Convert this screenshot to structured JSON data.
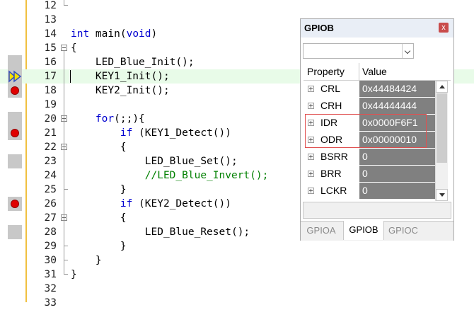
{
  "editor": {
    "lines": [
      {
        "num": "12",
        "segments": [],
        "fold": "end-top"
      },
      {
        "num": "13",
        "segments": []
      },
      {
        "num": "14",
        "segments": [
          {
            "t": "int",
            "c": "kw"
          },
          {
            "t": " main(",
            "c": ""
          },
          {
            "t": "void",
            "c": "kw"
          },
          {
            "t": ")",
            "c": ""
          }
        ]
      },
      {
        "num": "15",
        "segments": [
          {
            "t": "{",
            "c": ""
          }
        ],
        "fold": "box"
      },
      {
        "num": "16",
        "segments": [
          {
            "t": "    LED_Blue_Init();",
            "c": ""
          }
        ],
        "gutter": "gray"
      },
      {
        "num": "17",
        "segments": [
          {
            "t": "    KEY1_Init();",
            "c": ""
          }
        ],
        "gutter": "arrow",
        "current": true
      },
      {
        "num": "18",
        "segments": [
          {
            "t": "    KEY2_Init();",
            "c": ""
          }
        ],
        "gutter": "breakpoint"
      },
      {
        "num": "19",
        "segments": []
      },
      {
        "num": "20",
        "segments": [
          {
            "t": "    ",
            "c": ""
          },
          {
            "t": "for",
            "c": "kw"
          },
          {
            "t": "(;;){",
            "c": ""
          }
        ],
        "fold": "box",
        "gutter": "gray"
      },
      {
        "num": "21",
        "segments": [
          {
            "t": "        ",
            "c": ""
          },
          {
            "t": "if",
            "c": "kw"
          },
          {
            "t": " (KEY1_Detect())",
            "c": ""
          }
        ],
        "gutter": "breakpoint"
      },
      {
        "num": "22",
        "segments": [
          {
            "t": "        {",
            "c": ""
          }
        ],
        "fold": "box"
      },
      {
        "num": "23",
        "segments": [
          {
            "t": "            LED_Blue_Set();",
            "c": ""
          }
        ],
        "gutter": "gray"
      },
      {
        "num": "24",
        "segments": [
          {
            "t": "            //LED_Blue_Invert();",
            "c": "cm"
          }
        ]
      },
      {
        "num": "25",
        "segments": [
          {
            "t": "        }",
            "c": ""
          }
        ],
        "fold": "end"
      },
      {
        "num": "26",
        "segments": [
          {
            "t": "        ",
            "c": ""
          },
          {
            "t": "if",
            "c": "kw"
          },
          {
            "t": " (KEY2_Detect())",
            "c": ""
          }
        ],
        "gutter": "breakpoint"
      },
      {
        "num": "27",
        "segments": [
          {
            "t": "        {",
            "c": ""
          }
        ],
        "fold": "box"
      },
      {
        "num": "28",
        "segments": [
          {
            "t": "            LED_Blue_Reset();",
            "c": ""
          }
        ],
        "gutter": "gray"
      },
      {
        "num": "29",
        "segments": [
          {
            "t": "        }",
            "c": ""
          }
        ],
        "fold": "end"
      },
      {
        "num": "30",
        "segments": [
          {
            "t": "    }",
            "c": ""
          }
        ],
        "fold": "end"
      },
      {
        "num": "31",
        "segments": [
          {
            "t": "}",
            "c": ""
          }
        ],
        "fold": "end"
      },
      {
        "num": "32",
        "segments": []
      },
      {
        "num": "33",
        "segments": []
      }
    ]
  },
  "gpio_window": {
    "title": "GPIOB",
    "close_glyph": "x",
    "header_property": "Property",
    "header_value": "Value",
    "registers": [
      {
        "name": "CRL",
        "value": "0x44484424"
      },
      {
        "name": "CRH",
        "value": "0x44444444"
      },
      {
        "name": "IDR",
        "value": "0x0000F6F1"
      },
      {
        "name": "ODR",
        "value": "0x00000010"
      },
      {
        "name": "BSRR",
        "value": "0"
      },
      {
        "name": "BRR",
        "value": "0"
      },
      {
        "name": "LCKR",
        "value": "0"
      }
    ],
    "tabs": [
      {
        "label": "GPIOA",
        "active": false
      },
      {
        "label": "GPIOB",
        "active": true
      },
      {
        "label": "GPIOC",
        "active": false
      }
    ]
  },
  "colors": {
    "breakpoint": "#e00000",
    "current_line": "#e8fbe8",
    "keyword": "#0000d0",
    "comment": "#008000",
    "value_cell": "#808080",
    "highlight_box": "#e05050"
  }
}
